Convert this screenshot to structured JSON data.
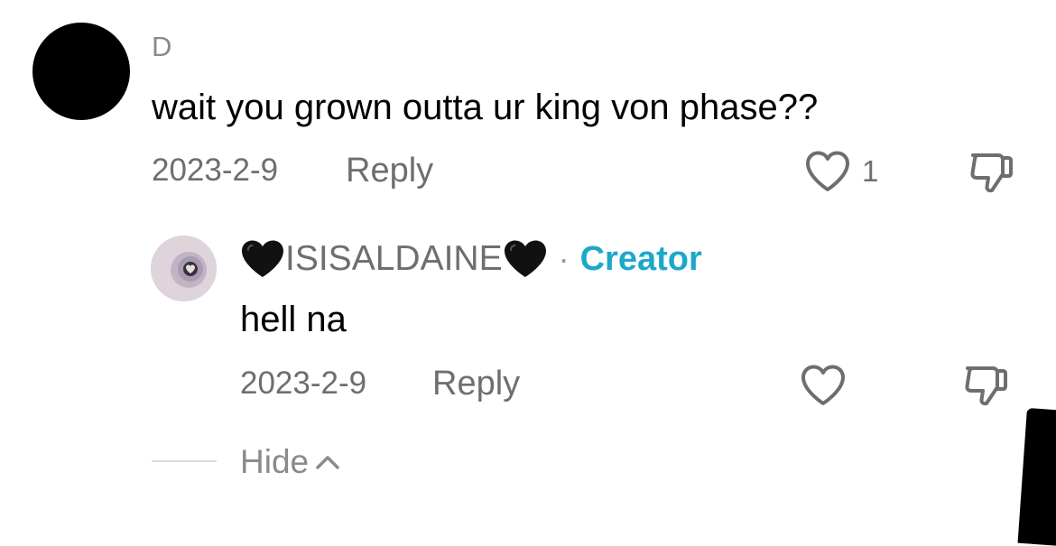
{
  "comment": {
    "username": "D",
    "text": "wait you grown outta ur king von phase??",
    "date": "2023-2-9",
    "reply_label": "Reply",
    "like_count": "1",
    "icons": {
      "like": "heart-outline-icon",
      "dislike": "thumbs-down-icon"
    }
  },
  "reply": {
    "username": "ISISALDAINE",
    "username_emoji": "black-heart",
    "separator": "·",
    "creator_label": "Creator",
    "text": "hell na",
    "date": "2023-2-9",
    "reply_label": "Reply",
    "icons": {
      "like": "heart-outline-icon",
      "dislike": "thumbs-down-icon"
    }
  },
  "thread": {
    "hide_label": "Hide",
    "hide_icon": "chevron-up-icon"
  },
  "colors": {
    "text_primary": "#000000",
    "text_secondary": "#6e6e6e",
    "creator_accent": "#1da8c8"
  }
}
